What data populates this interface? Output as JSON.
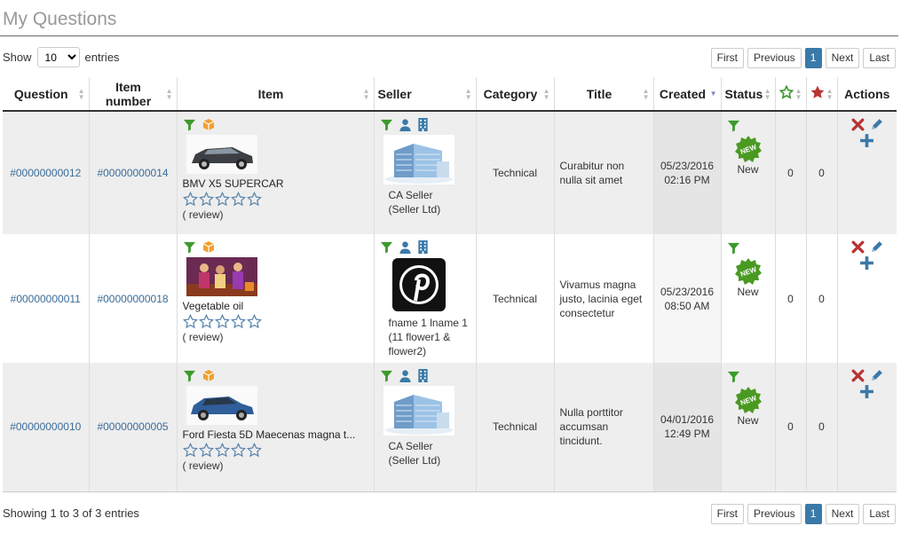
{
  "page_title": "My Questions",
  "length": {
    "prefix": "Show",
    "value": "10",
    "suffix": "entries"
  },
  "pager": {
    "first": "First",
    "previous": "Previous",
    "page": "1",
    "next": "Next",
    "last": "Last"
  },
  "columns": {
    "question": "Question",
    "item_number": "Item number",
    "item": "Item",
    "seller": "Seller",
    "category": "Category",
    "title": "Title",
    "created": "Created",
    "status": "Status",
    "actions": "Actions"
  },
  "rows": [
    {
      "question": "#00000000012",
      "item_number": "#00000000014",
      "item_name": "BMV X5 SUPERCAR",
      "item_image": "suv-car-photo",
      "review": "( review)",
      "seller_image": "office-building-photo",
      "seller_line1": "CA Seller",
      "seller_line2": "(Seller Ltd)",
      "seller_line3": "",
      "category": "Technical",
      "title": "Curabitur non nulla sit amet",
      "created_date": "05/23/2016",
      "created_time": "02:16 PM",
      "status": "New",
      "count_green": "0",
      "count_red": "0"
    },
    {
      "question": "#00000000011",
      "item_number": "#00000000018",
      "item_name": "Vegetable oil",
      "item_image": "movie-scene-photo",
      "review": "( review)",
      "seller_image": "pinterest-logo",
      "seller_line1": "fname 1 lname 1",
      "seller_line2": "(11 flower1 &",
      "seller_line3": "flower2)",
      "category": "Technical",
      "title": "Vivamus magna justo, lacinia eget consectetur",
      "created_date": "05/23/2016",
      "created_time": "08:50 AM",
      "status": "New",
      "count_green": "0",
      "count_red": "0"
    },
    {
      "question": "#00000000010",
      "item_number": "#00000000005",
      "item_name": "Ford Fiesta 5D Maecenas magna t...",
      "item_image": "blue-hatchback-photo",
      "review": "( review)",
      "seller_image": "office-building-photo",
      "seller_line1": "CA Seller",
      "seller_line2": "(Seller Ltd)",
      "seller_line3": "",
      "category": "Technical",
      "title": "Nulla porttitor accumsan tincidunt.",
      "created_date": "04/01/2016",
      "created_time": "12:49 PM",
      "status": "New",
      "count_green": "0",
      "count_red": "0"
    }
  ],
  "badge_text": "NEW",
  "info": "Showing 1 to 3 of 3 entries",
  "colors": {
    "accent": "#3a79a8",
    "link": "#3a6c99",
    "green": "#3c9a2c",
    "orange": "#f0a030",
    "red": "#b73434",
    "new_badge": "#4a9a22"
  }
}
